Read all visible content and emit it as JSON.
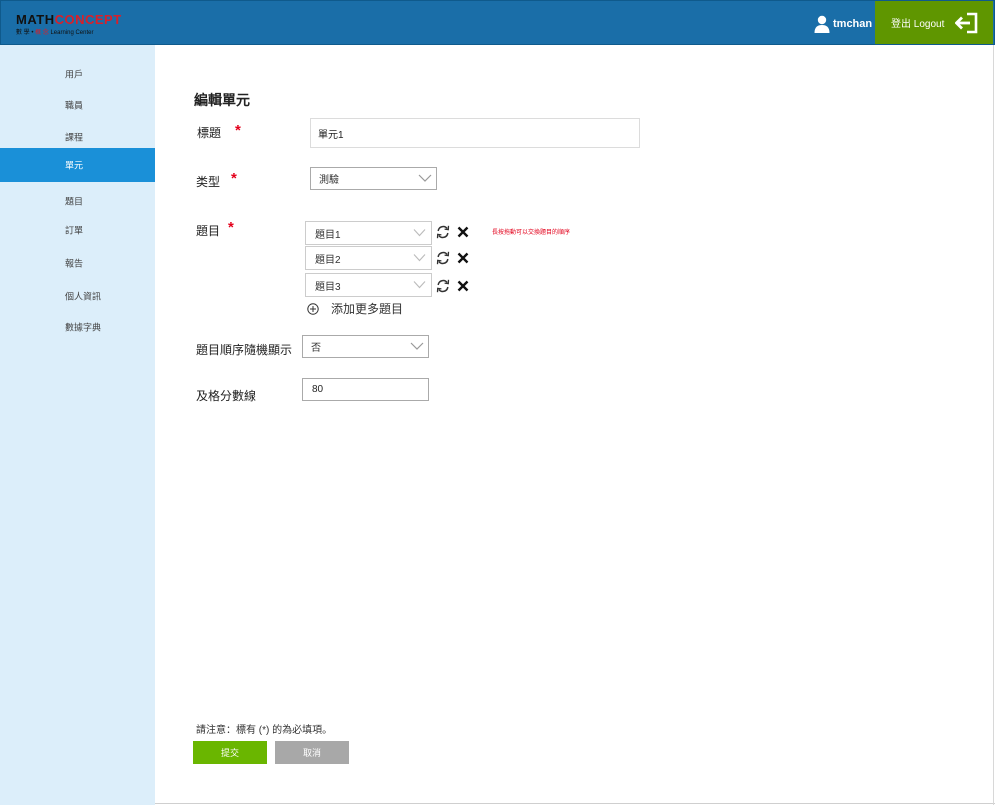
{
  "header": {
    "logo_main_a": "MATH",
    "logo_main_b": "CONCEPT",
    "logo_sub_a": "數 學 • ",
    "logo_sub_b": "概 念",
    "logo_sub_c": " Learning Center",
    "username": "tmchan",
    "logout_label": "登出 Logout"
  },
  "sidebar": {
    "items": [
      {
        "label": "用戶",
        "active": false
      },
      {
        "label": "職員",
        "active": false
      },
      {
        "label": "課程",
        "active": false
      },
      {
        "label": "單元",
        "active": true
      },
      {
        "label": "題目",
        "active": false
      },
      {
        "label": "訂單",
        "active": false
      },
      {
        "label": "報告",
        "active": false
      },
      {
        "label": "個人資訊",
        "active": false
      },
      {
        "label": "數據字典",
        "active": false
      }
    ]
  },
  "form": {
    "page_title": "編輯單元",
    "title_label": "標題",
    "title_value": "單元1",
    "type_label": "类型",
    "type_value": "測驗",
    "questions_label": "題目",
    "questions": [
      "題目1",
      "題目2",
      "題目3"
    ],
    "reorder_hint": "長按拖動可以交換題目的順序",
    "add_more_label": "添加更多題目",
    "random_label": "題目順序隨機顯示",
    "random_value": "否",
    "pass_label": "及格分數線",
    "pass_value": "80",
    "required_mark": "*",
    "note": "請注意：標有 (*) 的為必填項。",
    "submit_label": "提交",
    "cancel_label": "取消"
  },
  "colors": {
    "header": "#1a6ea8",
    "logout": "#5f9600",
    "sidebar": "#dceefa",
    "active": "#1a90d8",
    "required": "#e3001b",
    "submit": "#6ab600",
    "cancel": "#a8a8a8"
  }
}
